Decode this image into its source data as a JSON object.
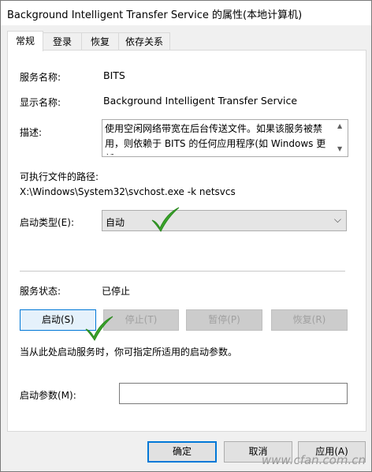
{
  "window": {
    "title": "Background Intelligent Transfer Service 的属性(本地计算机)"
  },
  "tabs": [
    {
      "label": "常规",
      "active": true
    },
    {
      "label": "登录",
      "active": false
    },
    {
      "label": "恢复",
      "active": false
    },
    {
      "label": "依存关系",
      "active": false
    }
  ],
  "general": {
    "service_name_label": "服务名称:",
    "service_name_value": "BITS",
    "display_name_label": "显示名称:",
    "display_name_value": "Background Intelligent Transfer Service",
    "description_label": "描述:",
    "description_value": "使用空闲网络带宽在后台传送文件。如果该服务被禁用，则依赖于 BITS 的任何应用程序(如 Windows 更新",
    "exe_path_label": "可执行文件的路径:",
    "exe_path_value": "X:\\Windows\\System32\\svchost.exe -k netsvcs",
    "startup_type_label": "启动类型(E):",
    "startup_type_value": "自动",
    "service_status_label": "服务状态:",
    "service_status_value": "已停止",
    "start_button": "启动(S)",
    "stop_button": "停止(T)",
    "pause_button": "暂停(P)",
    "resume_button": "恢复(R)",
    "hint": "当从此处启动服务时，你可指定所适用的启动参数。",
    "start_params_label": "启动参数(M):",
    "start_params_value": ""
  },
  "footer": {
    "ok_button": "确定",
    "cancel_button": "取消",
    "apply_button": "应用(A)"
  },
  "watermark": "www.cfan.com.cn",
  "colors": {
    "check_mark": "#3aa52a",
    "focus_border": "#0078d7"
  }
}
